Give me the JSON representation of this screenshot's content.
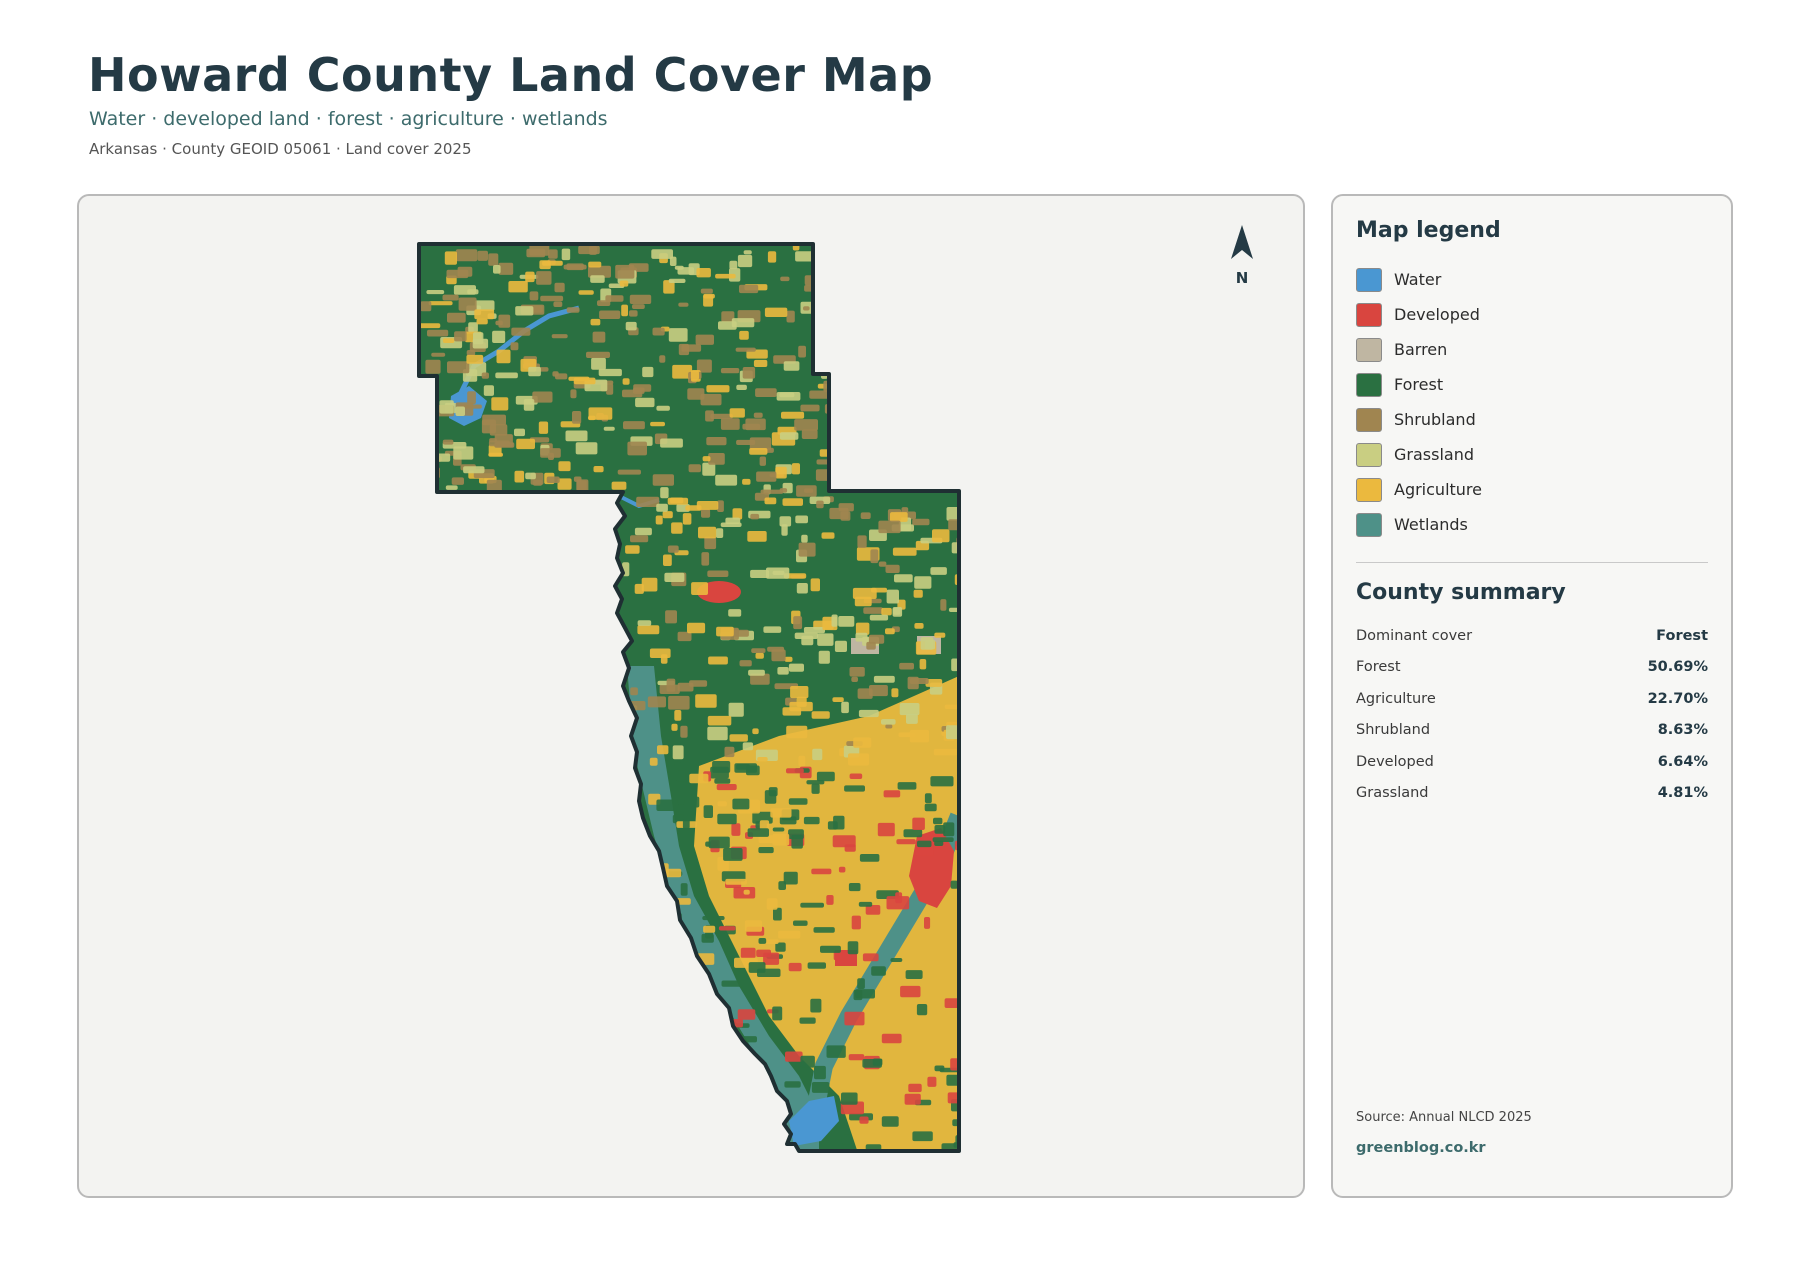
{
  "header": {
    "title": "Howard County Land Cover Map",
    "subtitle": "Water · developed land · forest · agriculture · wetlands",
    "meta": "Arkansas · County GEOID 05061 · Land cover 2025"
  },
  "map": {
    "north_label": "N",
    "county_fill": "#2a7041",
    "border_color": "#1f2f33"
  },
  "legend": {
    "title": "Map legend",
    "items": [
      {
        "label": "Water",
        "color": "#4a97d2"
      },
      {
        "label": "Developed",
        "color": "#d9453f"
      },
      {
        "label": "Barren",
        "color": "#bfb6a2"
      },
      {
        "label": "Forest",
        "color": "#2a7041"
      },
      {
        "label": "Shrubland",
        "color": "#a08550"
      },
      {
        "label": "Grassland",
        "color": "#c9ce82"
      },
      {
        "label": "Agriculture",
        "color": "#ebb93e"
      },
      {
        "label": "Wetlands",
        "color": "#4e9188"
      }
    ]
  },
  "summary": {
    "title": "County summary",
    "rows": [
      {
        "label": "Dominant cover",
        "value": "Forest"
      },
      {
        "label": "Forest",
        "value": "50.69%"
      },
      {
        "label": "Agriculture",
        "value": "22.70%"
      },
      {
        "label": "Shrubland",
        "value": "8.63%"
      },
      {
        "label": "Developed",
        "value": "6.64%"
      },
      {
        "label": "Grassland",
        "value": "4.81%"
      }
    ]
  },
  "footer": {
    "source": "Source: Annual NLCD 2025",
    "site": "greenblog.co.kr"
  }
}
